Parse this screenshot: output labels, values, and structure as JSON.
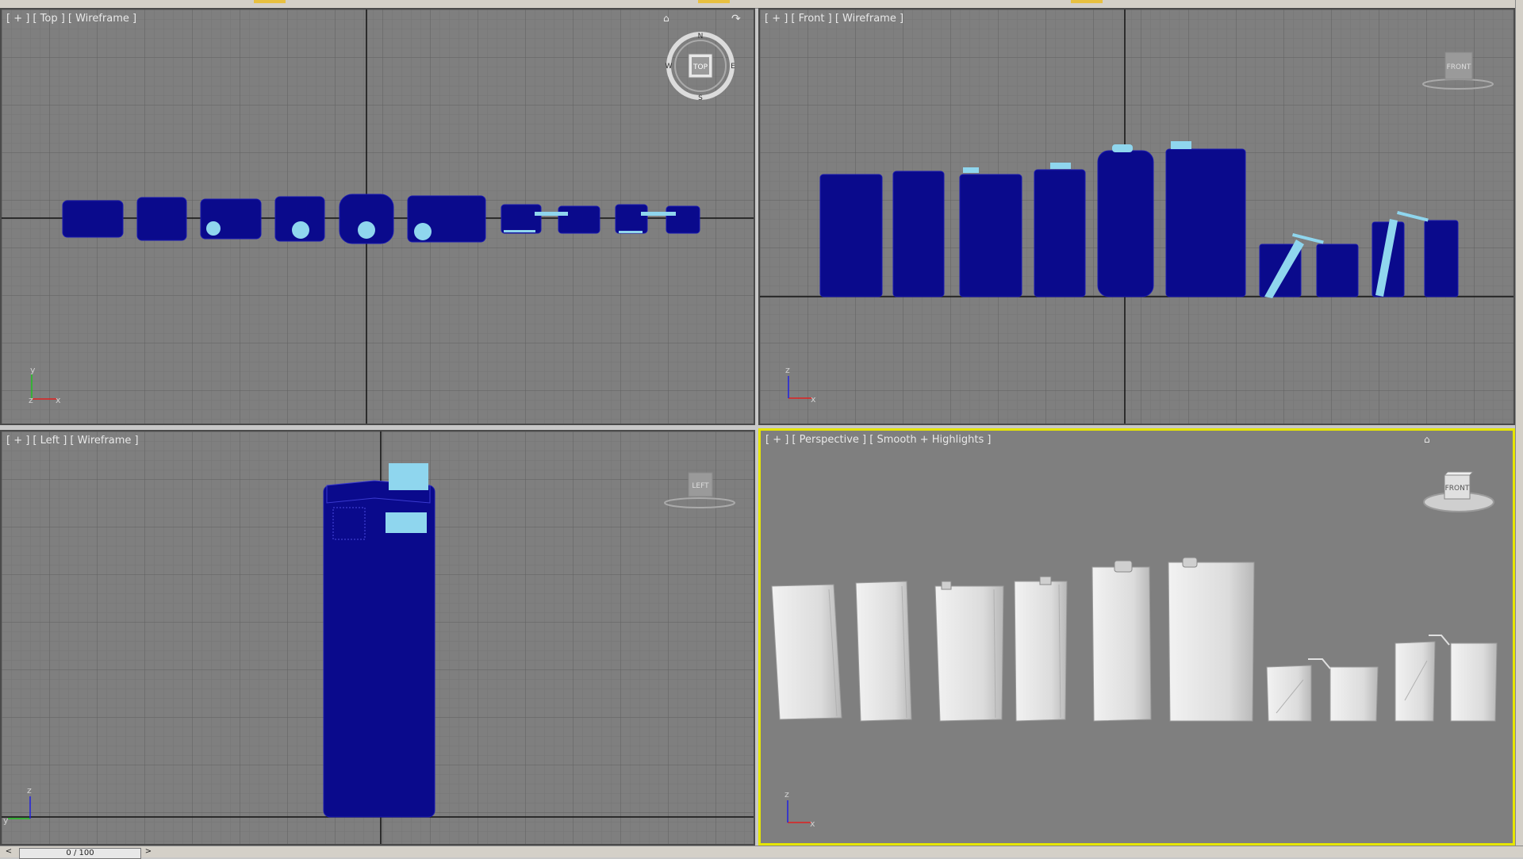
{
  "viewports": {
    "top": {
      "label": "[ + ] [ Top ] [ Wireframe ]",
      "cube": "TOP",
      "compass": [
        "N",
        "E",
        "S",
        "W"
      ],
      "axes": [
        "y",
        "z",
        "x"
      ]
    },
    "front": {
      "label": "[ + ] [ Front ] [ Wireframe ]",
      "cube": "FRONT",
      "axes": [
        "z",
        "x"
      ]
    },
    "left": {
      "label": "[ + ] [ Left ] [ Wireframe ]",
      "cube": "LEFT",
      "axes": [
        "z",
        "y"
      ]
    },
    "perspective": {
      "label": "[ + ] [ Perspective ] [ Smooth + Highlights ]",
      "cube": "FRONT",
      "axes": [
        "z",
        "x"
      ]
    }
  },
  "timeline": {
    "frame": "0 / 100",
    "prev": "<",
    "next": ">"
  },
  "colors": {
    "active_border": "#e6e600",
    "wire": "#0a0a8c",
    "selected": "#8fd6ee",
    "viewport_bg": "#7f7f7f",
    "grid": "#737373",
    "axis_x": "#e02020",
    "axis_y": "#20c020",
    "axis_z": "#2020e0"
  }
}
